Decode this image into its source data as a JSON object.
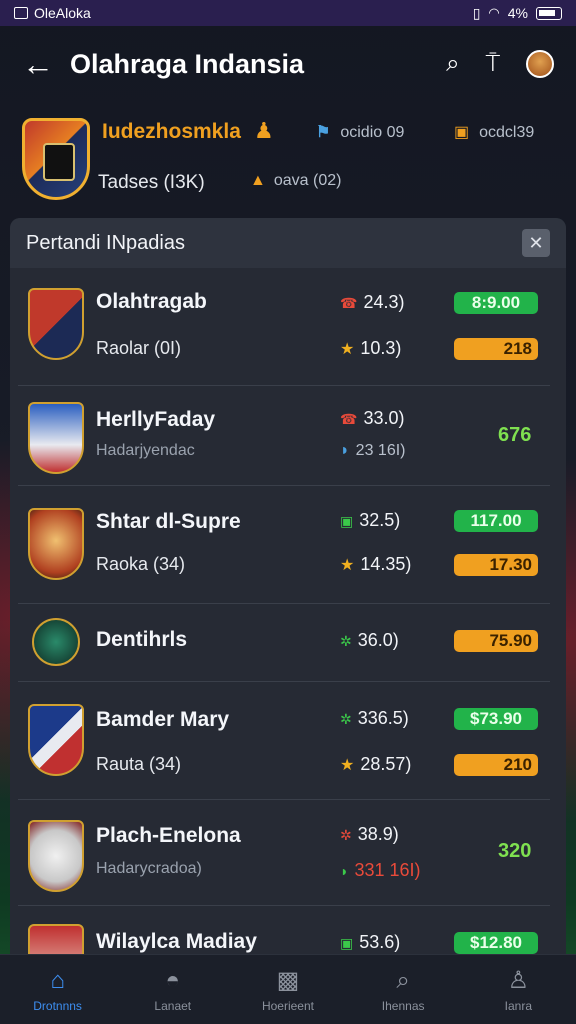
{
  "status_bar": {
    "left_text": "OleAloka",
    "battery": "4%"
  },
  "app_bar": {
    "title": "Olahraga Indansia"
  },
  "league": {
    "name": "Iudezhosmkla",
    "stat1": "ocidio 09",
    "stat2": "ocdcl39",
    "teams": "Tadses (I3K)",
    "stat3": "oava (02)"
  },
  "panel": {
    "title": "Pertandi INpadias"
  },
  "matches": [
    {
      "name": "Olahtragab",
      "sub": "Raolar (0I)",
      "stat1": "24.3)",
      "stat2": "10.3)",
      "badge_value": "8:9.00",
      "badge2_value": "218"
    },
    {
      "name": "HerllyFaday",
      "sub": "Hadarjyendac",
      "stat1": "33.0)",
      "stat2": "23 16I)",
      "value": "676"
    },
    {
      "name": "Shtar dl-Supre",
      "sub": "Raoka (34)",
      "stat1": "32.5)",
      "stat2": "14.35)",
      "badge_value": "117.00",
      "badge2_value": "17.30"
    },
    {
      "name": "Dentihrls",
      "stat1": "36.0)",
      "badge2_value": "75.90"
    },
    {
      "name": "Bamder Mary",
      "sub": "Rauta (34)",
      "stat1": "336.5)",
      "stat2": "28.57)",
      "badge_value": "$73.90",
      "badge2_value": "210"
    },
    {
      "name": "Plach-Enelona",
      "sub": "Hadarycradoa)",
      "stat1": "38.9)",
      "stat2": "331 16I)",
      "value": "320"
    },
    {
      "name": "Wilaylca Madiay",
      "stat1": "53.6)",
      "badge_value": "$12.80"
    }
  ],
  "bottom_nav": [
    {
      "label": "Drotnnns",
      "icon": "home-icon"
    },
    {
      "label": "Lanaet",
      "icon": "stadium-icon"
    },
    {
      "label": "Hoerieent",
      "icon": "trophy-icon"
    },
    {
      "label": "Ihennas",
      "icon": "search-icon"
    },
    {
      "label": "Ianra",
      "icon": "profile-icon"
    }
  ],
  "colors": {
    "accent": "#3d8ef0",
    "orange": "#f0a020",
    "green": "#22b34a",
    "red": "#e84a3a"
  }
}
